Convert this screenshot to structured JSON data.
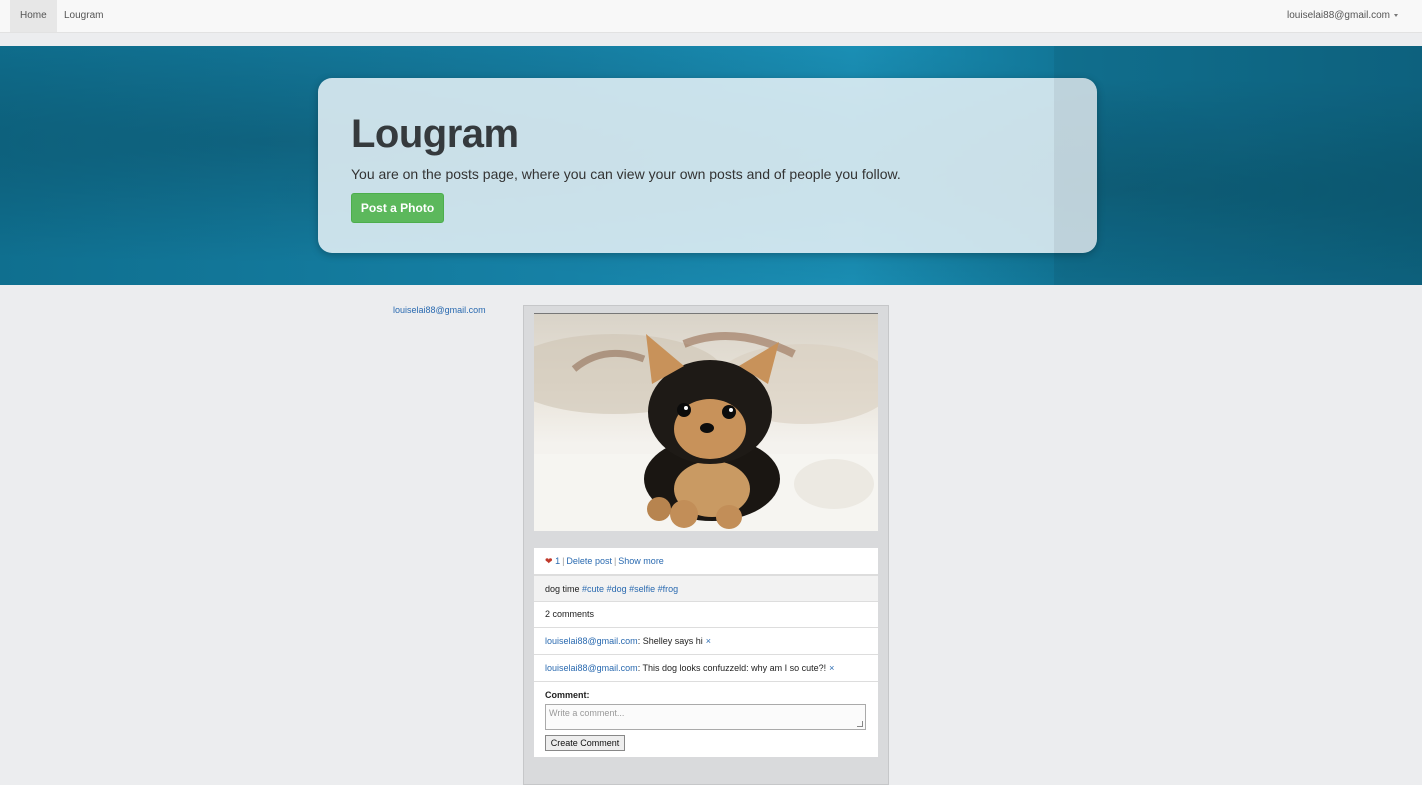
{
  "navbar": {
    "home_label": "Home",
    "brand_label": "Lougram",
    "user_label": "louiselai88@gmail.com"
  },
  "hero": {
    "title": "Lougram",
    "lead": "You are on the posts page, where you can view your own posts and of people you follow.",
    "post_button": "Post a Photo"
  },
  "sidebar": {
    "user_link": "louiselai88@gmail.com"
  },
  "post": {
    "image_icon": "puppy-photo",
    "likes": "1",
    "delete_label": "Delete post",
    "show_more_label": "Show more",
    "caption_text": "dog time",
    "hashtags": [
      "#cute",
      "#dog",
      "#selfie",
      "#frog"
    ],
    "comment_count_label": "2 comments",
    "comments": [
      {
        "author": "louiselai88@gmail.com",
        "text": ": Shelley says hi",
        "remove": "×"
      },
      {
        "author": "louiselai88@gmail.com",
        "text": ": This dog looks confuzzeld: why am I so cute?!",
        "remove": "×"
      }
    ],
    "form": {
      "label": "Comment:",
      "placeholder": "Write a comment...",
      "submit_label": "Create Comment"
    }
  },
  "colors": {
    "accent_button": "#5cb85c",
    "link": "#2a6ab0",
    "hero_bg": "#1681a6"
  }
}
